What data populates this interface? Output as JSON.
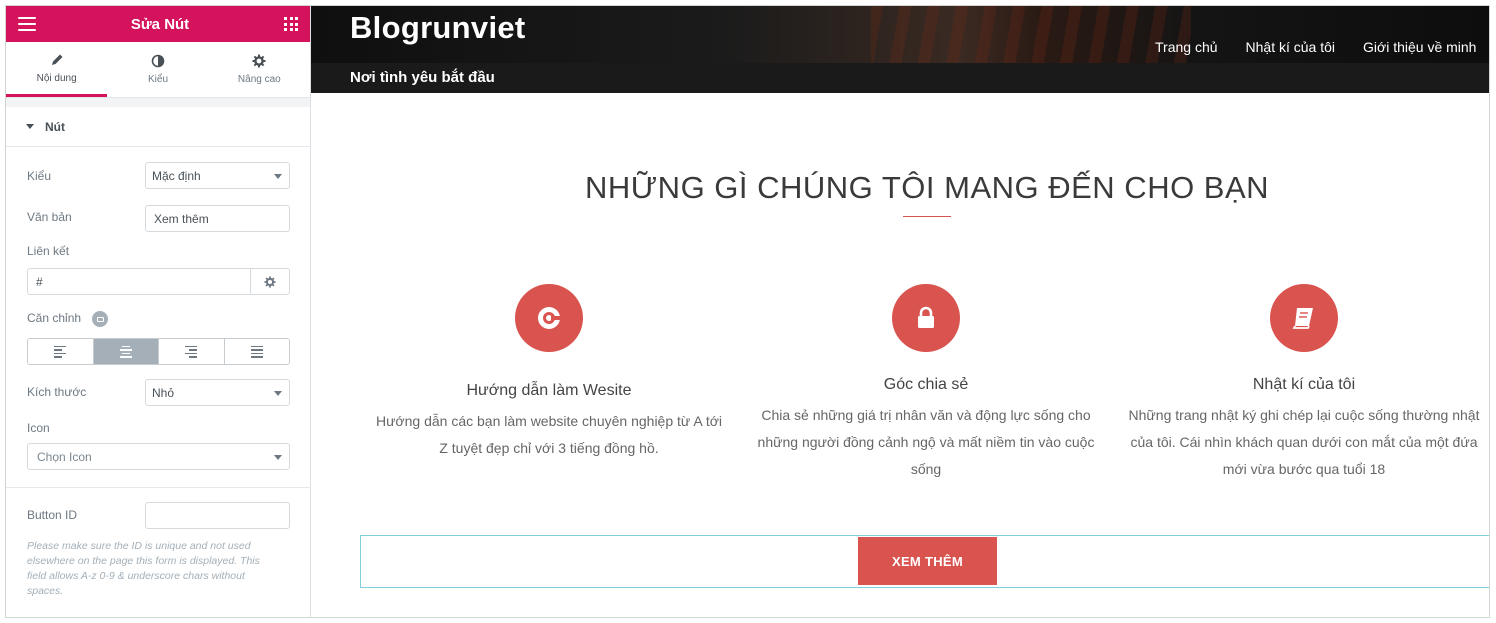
{
  "editor": {
    "title": "Sửa Nút",
    "tabs": [
      {
        "label": "Nội dung",
        "icon": "pencil-icon"
      },
      {
        "label": "Kiểu",
        "icon": "half-circle-icon"
      },
      {
        "label": "Nâng cao",
        "icon": "gear-icon"
      }
    ],
    "section": "Nút",
    "fields": {
      "type_label": "Kiểu",
      "type_value": "Mặc định",
      "text_label": "Văn bản",
      "text_value": "Xem thêm",
      "link_label": "Liên kết",
      "link_value": "#",
      "align_label": "Căn chỉnh",
      "align_selected": "center",
      "size_label": "Kích thước",
      "size_value": "Nhỏ",
      "icon_label": "Icon",
      "icon_value": "Chọn Icon",
      "button_id_label": "Button ID",
      "button_id_value": "",
      "help_text": "Please make sure the ID is unique and not used elsewhere on the page this form is displayed. This field allows A-z 0-9 & underscore chars without spaces."
    },
    "accent_color": "#d5135d"
  },
  "site": {
    "logo": "Blogrunviet",
    "nav": [
      "Trang chủ",
      "Nhật kí của tôi",
      "Giới thiệu về minh"
    ],
    "tagline": "Nơi tình yêu bắt đầu",
    "section_title": "NHỮNG GÌ CHÚNG TÔI MANG ĐẾN CHO BẠN",
    "features": [
      {
        "icon": "compass-icon",
        "title": "Hướng dẫn làm Wesite",
        "description": "Hướng dẫn các bạn làm website chuyên nghiệp từ A tới Z tuyệt đẹp chỉ với 3 tiếng đồng hồ."
      },
      {
        "icon": "lock-icon",
        "title": "Góc chia sẻ",
        "description": "Chia sẻ những giá trị nhân văn và động lực sống cho những người đồng cảnh ngộ và mất niềm tin vào cuộc sống"
      },
      {
        "icon": "book-icon",
        "title": "Nhật kí của tôi",
        "description": "Những trang nhật ký ghi chép lại cuộc sống thường nhật của tôi. Cái nhìn khách quan dưới con mắt của một đứa mới vừa bước qua tuổi 18"
      }
    ],
    "cta": "XEM THÊM",
    "accent_color": "#d9534f"
  }
}
